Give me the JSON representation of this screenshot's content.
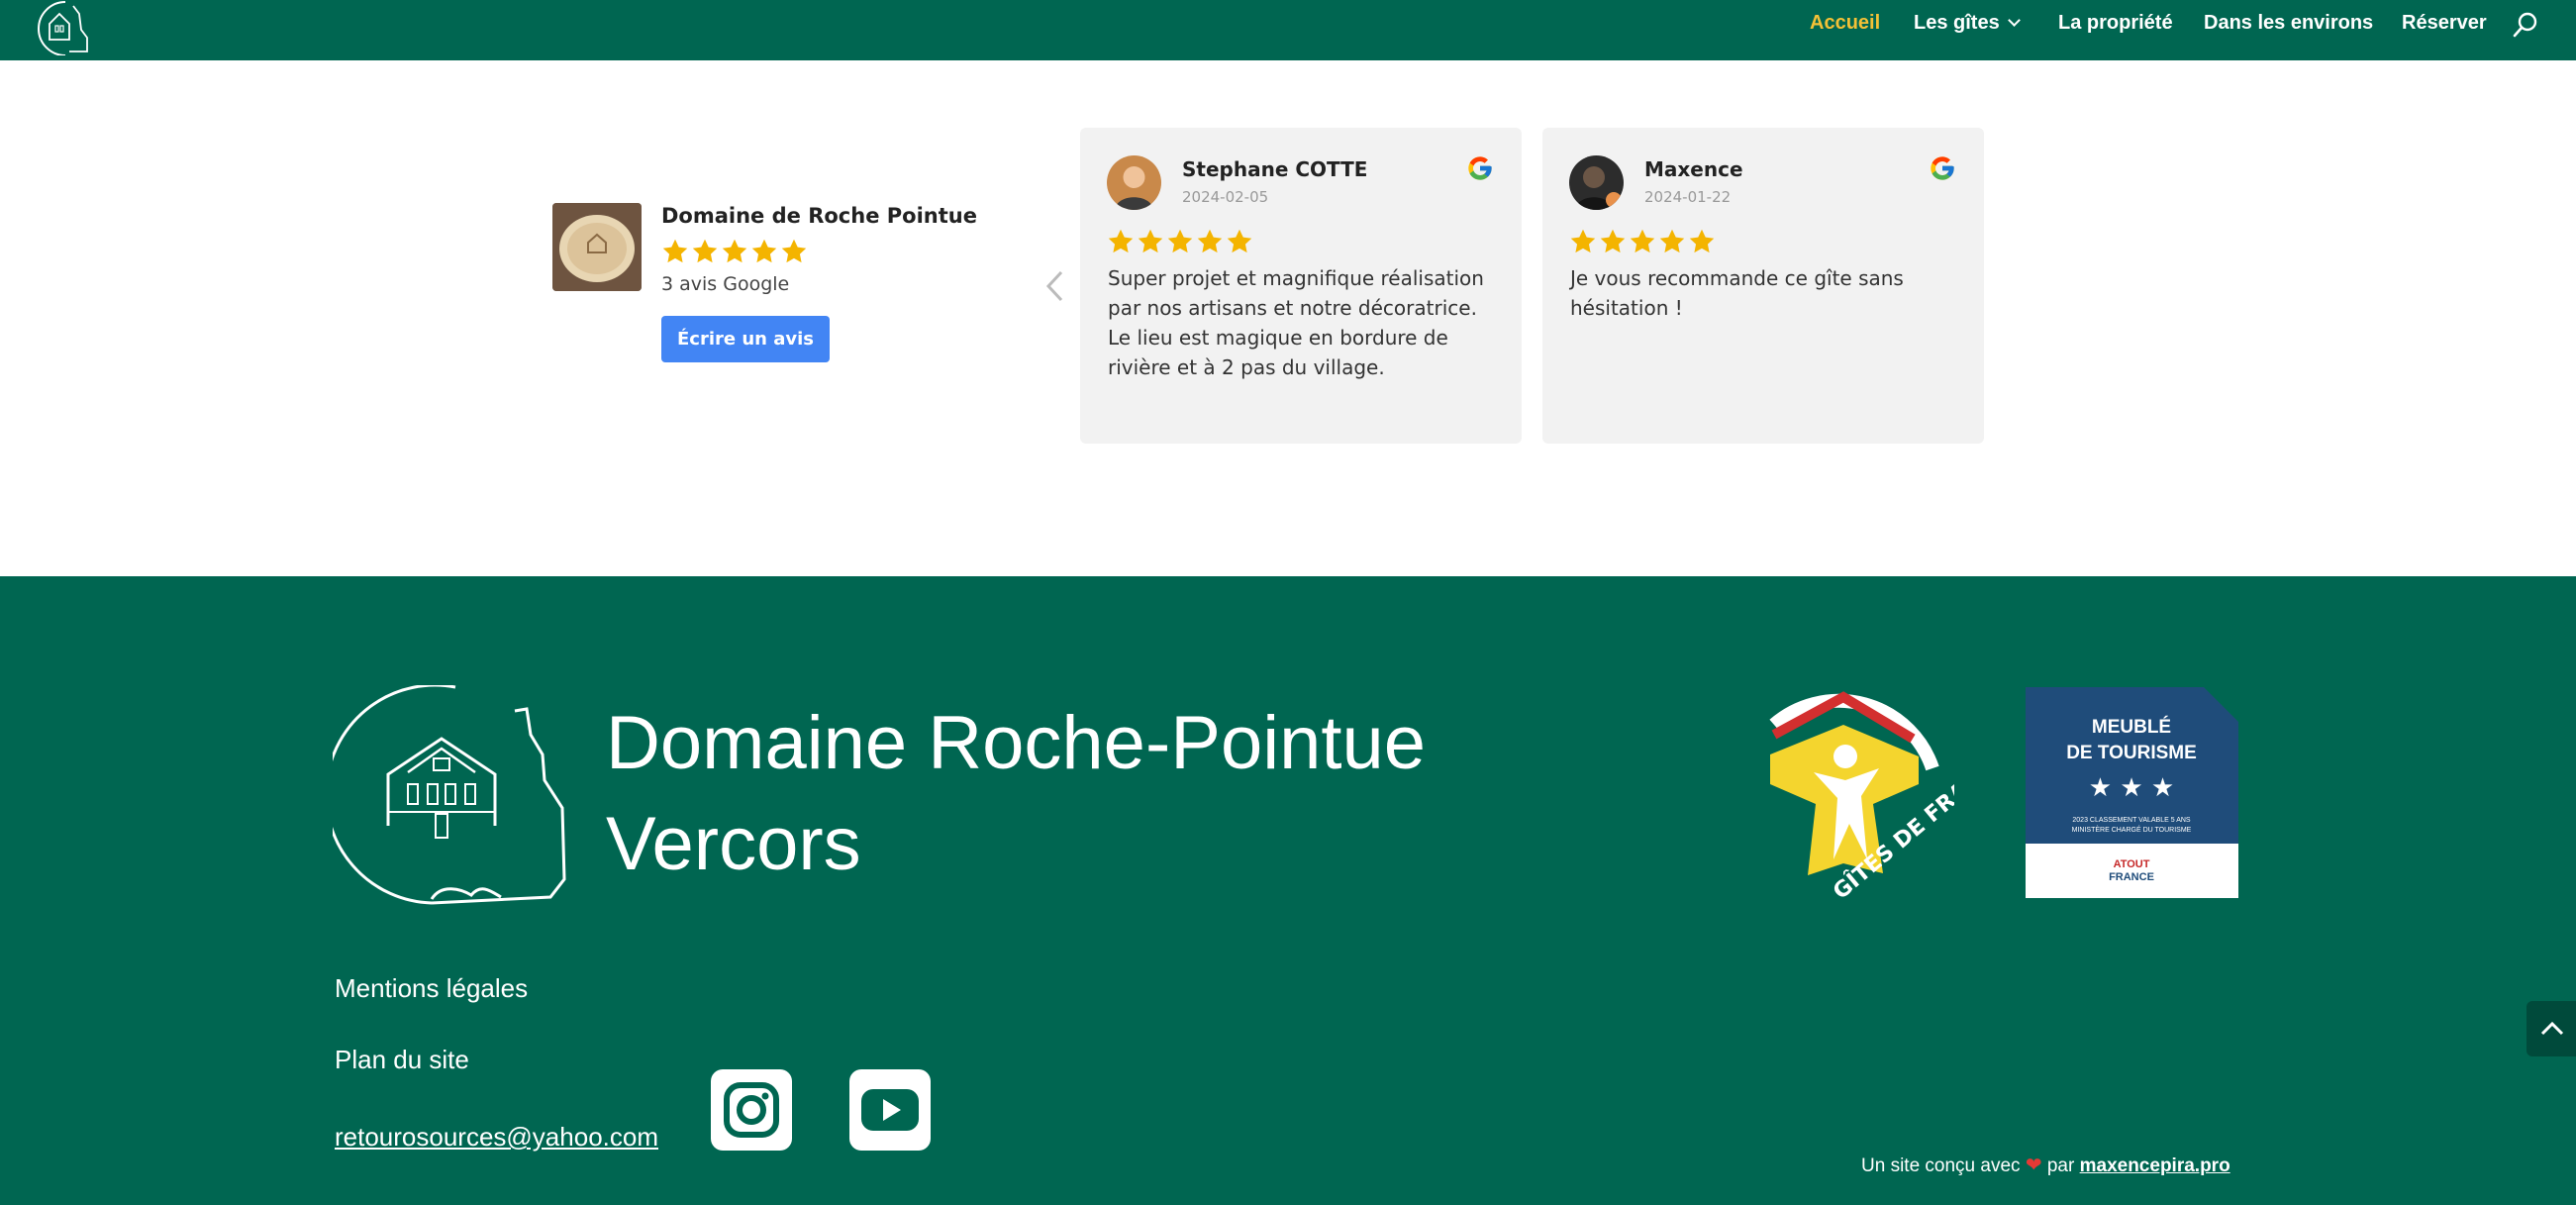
{
  "header": {
    "logo_label": "",
    "nav": [
      {
        "label": "Accueil",
        "active": true
      },
      {
        "label": "Les gîtes",
        "has_dropdown": true
      },
      {
        "label": "La propriété"
      },
      {
        "label": "Dans les environs"
      },
      {
        "label": "Réserver"
      }
    ],
    "search_icon": "search-icon"
  },
  "reviews": {
    "business": {
      "name": "Domaine de Roche Pointue",
      "rating": 5,
      "count_text": "3 avis Google",
      "write_button": "Écrire un avis"
    },
    "items": [
      {
        "author": "Stephane COTTE",
        "date": "2024-02-05",
        "rating": 5,
        "text": "Super projet et magnifique réalisation par nos artisans et notre décoratrice. Le lieu est magique en bordure de rivière et à 2 pas du village."
      },
      {
        "author": "Maxence",
        "date": "2024-01-22",
        "rating": 5,
        "text": "Je vous recommande ce gîte sans hésitation !"
      }
    ]
  },
  "footer": {
    "title_line1": "Domaine Roche-Pointue",
    "title_line2": "Vercors",
    "links": {
      "legal": "Mentions légales",
      "sitemap": "Plan du site",
      "email": "retourosources@yahoo.com"
    },
    "social": [
      "instagram-icon",
      "youtube-icon"
    ],
    "badges": {
      "gites_text": "GÎTES DE FRANCE",
      "meuble_line1": "MEUBLÉ",
      "meuble_line2": "DE TOURISME",
      "meuble_stars": "★ ★ ★",
      "meuble_small1": "2023 CLASSEMENT VALABLE 5 ANS",
      "meuble_small2": "MINISTÈRE CHARGÉ DU TOURISME",
      "atout_line1": "ATOUT",
      "atout_line2": "FRANCE"
    },
    "credit_prefix": "Un site conçu avec",
    "credit_by": "par",
    "credit_link": "maxencepira.pro"
  },
  "colors": {
    "brand_green": "#006651",
    "nav_active": "#f4c136",
    "star": "#f4b400",
    "google_blue": "#4285f4"
  }
}
